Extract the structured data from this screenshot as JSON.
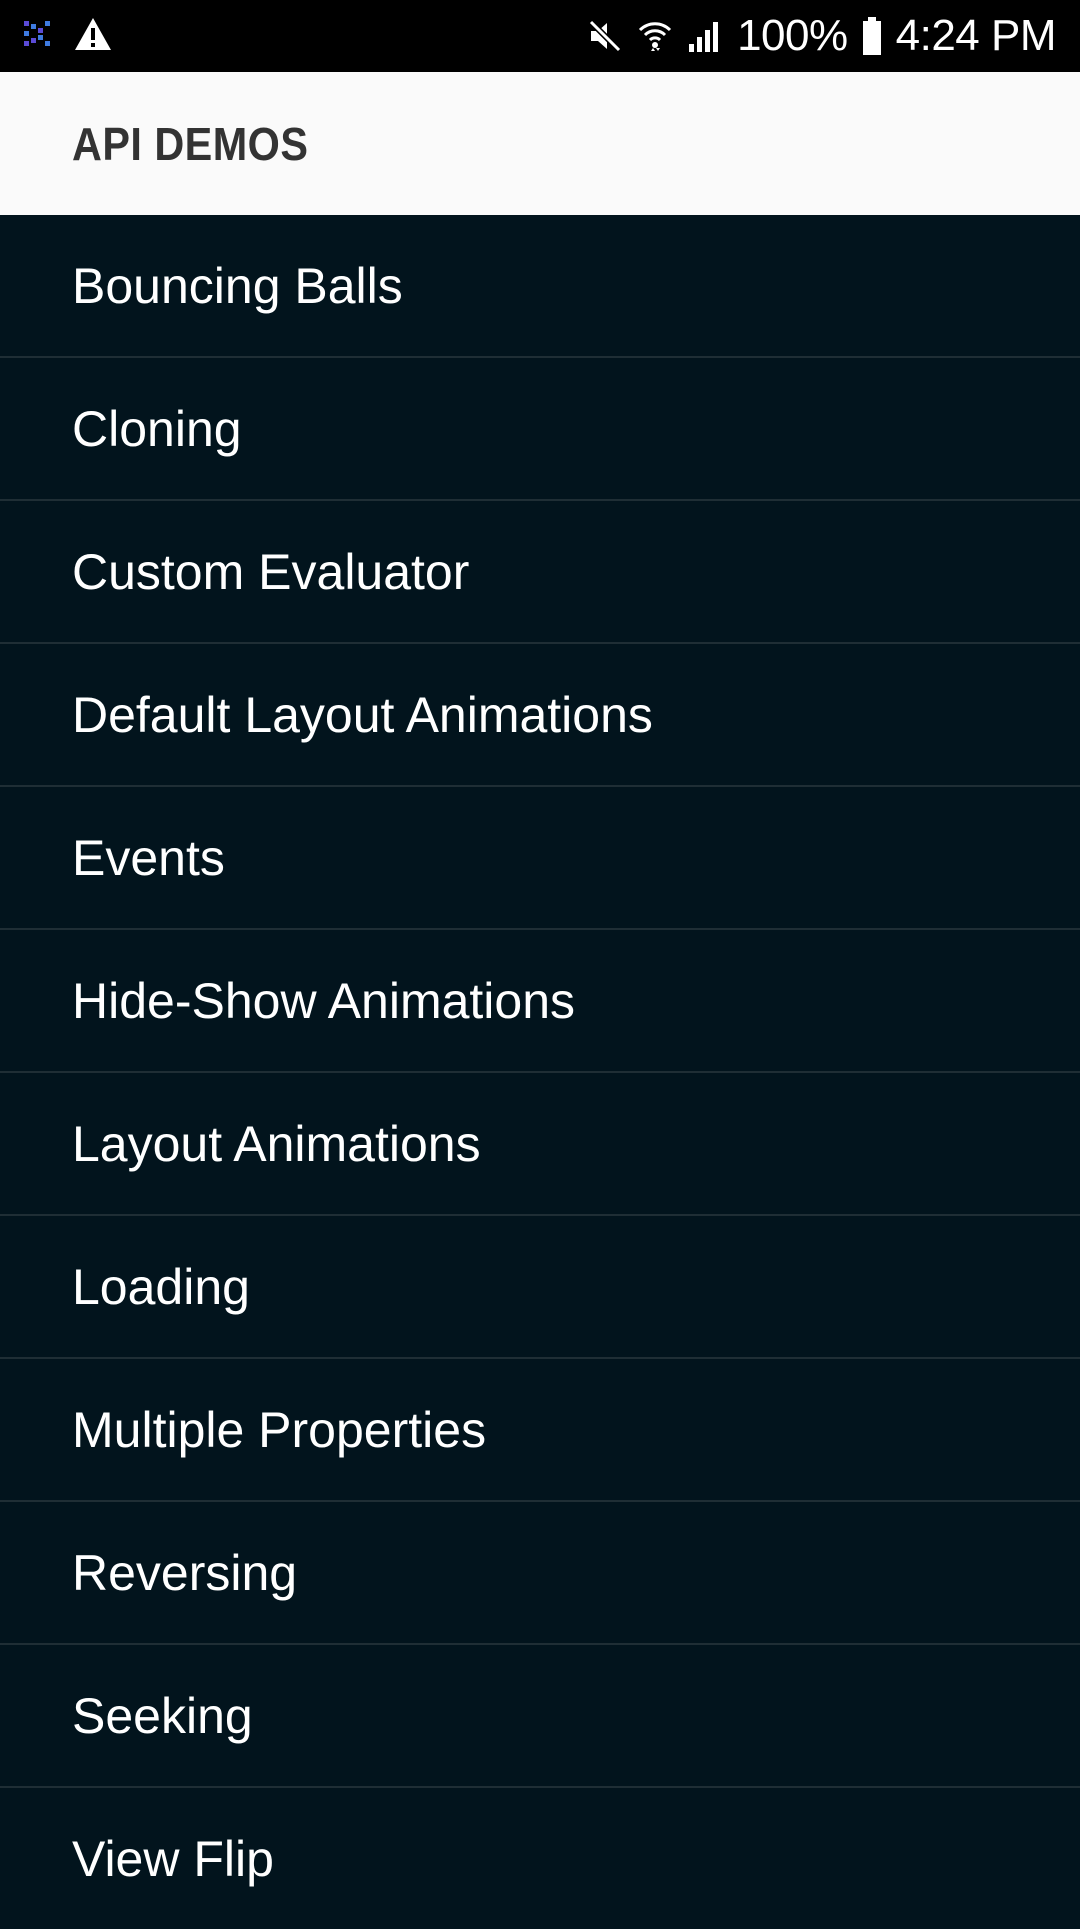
{
  "status_bar": {
    "left_icons": [
      "app-notification-icon",
      "warning-icon"
    ],
    "right_icons": [
      "mute-icon",
      "wifi-icon",
      "cell-signal-icon",
      "battery-icon"
    ],
    "battery": "100%",
    "time": "4:24 PM"
  },
  "app_bar": {
    "title": "API DEMOS"
  },
  "list": {
    "items": [
      {
        "label": "Bouncing Balls"
      },
      {
        "label": "Cloning"
      },
      {
        "label": "Custom Evaluator"
      },
      {
        "label": "Default Layout Animations"
      },
      {
        "label": "Events"
      },
      {
        "label": "Hide-Show Animations"
      },
      {
        "label": "Layout Animations"
      },
      {
        "label": "Loading"
      },
      {
        "label": "Multiple Properties"
      },
      {
        "label": "Reversing"
      },
      {
        "label": "Seeking"
      },
      {
        "label": "View Flip"
      }
    ]
  },
  "colors": {
    "status_bar_bg": "#000000",
    "app_bar_bg": "#fafafa",
    "title_text": "#333333",
    "list_bg": "#02141d",
    "divider": "#1f2e35",
    "list_text": "#ffffff"
  }
}
